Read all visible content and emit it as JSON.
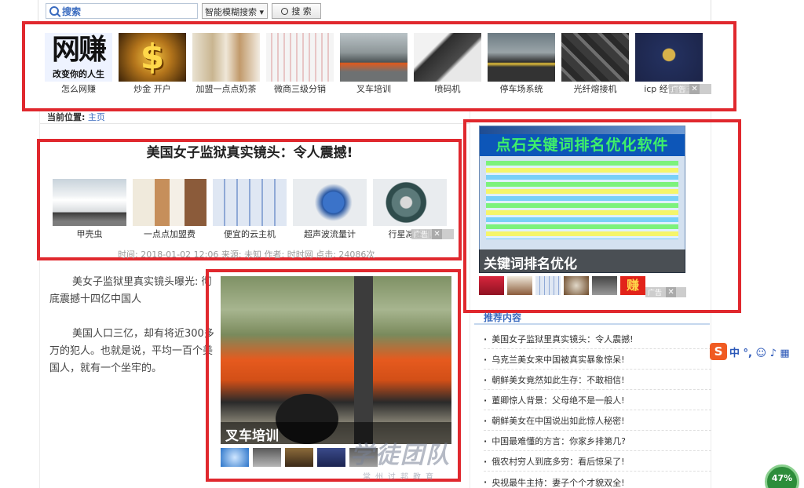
{
  "search": {
    "label": "搜索",
    "select_value": "智能模糊搜索 ▾",
    "button_label": "搜 索"
  },
  "top_ads": [
    {
      "caption": "怎么网赚",
      "overlay_big": "网赚",
      "overlay_small": "改变你的人生"
    },
    {
      "caption": "炒金 开户"
    },
    {
      "caption": "加盟一点点奶茶"
    },
    {
      "caption": "微商三级分销"
    },
    {
      "caption": "叉车培训"
    },
    {
      "caption": "喷码机"
    },
    {
      "caption": "停车场系统"
    },
    {
      "caption": "光纤熔接机"
    },
    {
      "caption": "icp 经营许可"
    }
  ],
  "ad_badge": {
    "label": "广告",
    "close": "✕"
  },
  "breadcrumb": {
    "label": "当前位置:",
    "link": "主页"
  },
  "article": {
    "title": "美国女子监狱真实镜头：令人震撼!",
    "inline_ads": [
      {
        "caption": "甲壳虫"
      },
      {
        "caption": "一点点加盟费"
      },
      {
        "caption": "便宜的云主机"
      },
      {
        "caption": "超声波流量计"
      },
      {
        "caption": "行星减速机"
      }
    ],
    "meta": "时间: 2018-01-02 12:06   来源: 未知   作者: 时时网   点击: 24086次",
    "para1_a": "美女子监狱里真实镜头曝光: 彻",
    "para1_b": "底震撼十四亿中国人",
    "para2_a": "美国人口三亿，却有将近300多",
    "para2_b": "万的犯人。也就是说，平均一百个美",
    "para2_c": "国人，就有一个坐牢的。"
  },
  "forklift_ad": {
    "banner": "叉车培训"
  },
  "software_ad": {
    "title": "点石关键词排名优化软件",
    "banner": "关键词排名优化",
    "thumb_text": "赚"
  },
  "recommend": {
    "heading": "推荐内容",
    "items": [
      "美国女子监狱里真实镜头：令人震撼!",
      "乌克兰美女来中国被真实暴象惊呆!",
      "朝鲜美女竟然如此生存：不敢相信!",
      "董卿惊人背景：父母绝不是一般人!",
      "朝鲜美女在中国说出如此惊人秘密!",
      "中国最难懂的方言：你家乡排第几?",
      "俄农村穷人到底多穷：看后惊呆了!",
      "央视最牛主持：妻子个个才貌双全!"
    ]
  },
  "sogou": {
    "glyph": "S",
    "text": "中 °, ☺ ♪ ▦"
  },
  "progress": {
    "label": "47%",
    "value": 47
  },
  "watermark": {
    "main": "学徒团队",
    "sub": "常州过邦教育"
  },
  "colors": {
    "highlight": "#e0282e",
    "link": "#3a6bbf"
  }
}
